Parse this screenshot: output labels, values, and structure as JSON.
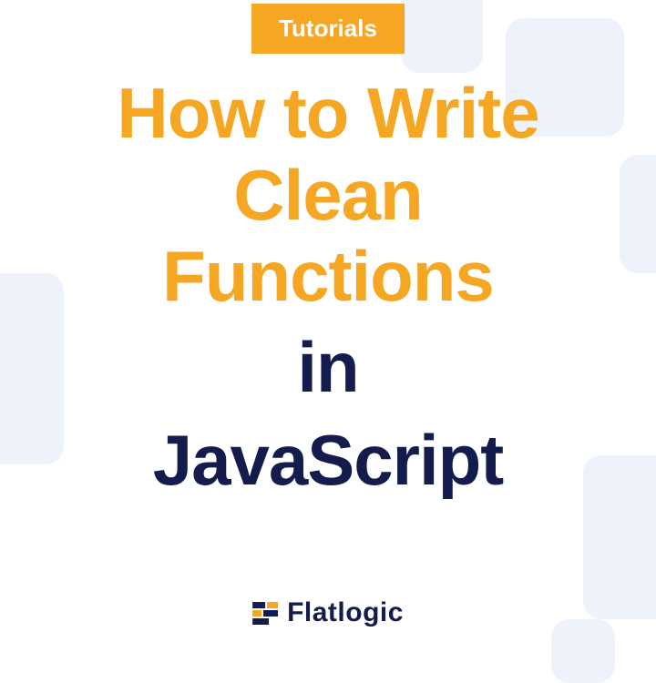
{
  "badge": {
    "label": "Tutorials"
  },
  "title": {
    "line1": "How to Write",
    "line2": "Clean",
    "line3": "Functions",
    "line4": "in",
    "line5": "JavaScript"
  },
  "brand": {
    "name": "Flatlogic"
  },
  "colors": {
    "accent_orange": "#f5a623",
    "navy": "#141b4d",
    "bg_tile": "#eef2fb"
  }
}
